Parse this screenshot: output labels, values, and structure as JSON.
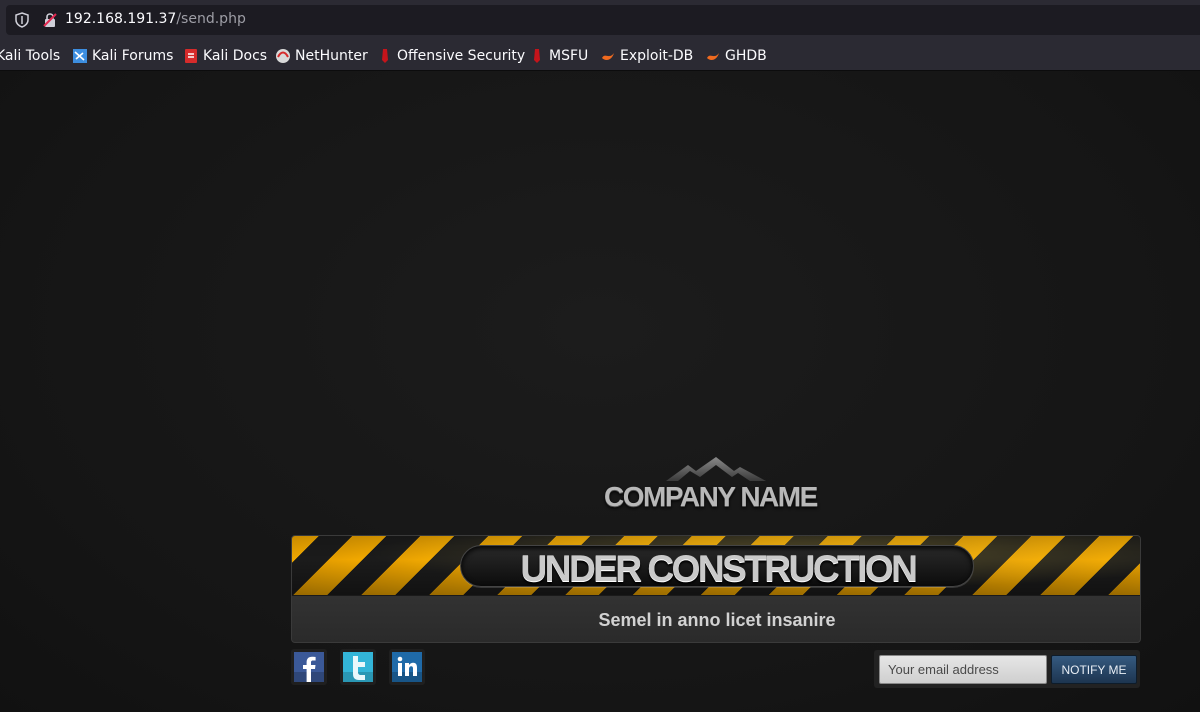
{
  "browser": {
    "url_host": "192.168.191.37",
    "url_path": "/send.php",
    "bookmarks": [
      {
        "label": "Kali Tools",
        "icon": "kali-tools-icon"
      },
      {
        "label": "Kali Forums",
        "icon": "kali-forums-icon"
      },
      {
        "label": "Kali Docs",
        "icon": "kali-docs-icon"
      },
      {
        "label": "NetHunter",
        "icon": "nethunter-icon"
      },
      {
        "label": "Offensive Security",
        "icon": "offsec-icon"
      },
      {
        "label": "MSFU",
        "icon": "msfu-icon"
      },
      {
        "label": "Exploit-DB",
        "icon": "exploit-db-icon"
      },
      {
        "label": "GHDB",
        "icon": "ghdb-icon"
      }
    ]
  },
  "page": {
    "company_name": "COMPANY NAME",
    "banner_title": "UNDER CONSTRUCTION",
    "tagline": "Semel in anno licet insanire",
    "social": [
      {
        "name": "facebook",
        "icon": "facebook-icon",
        "color": "#3b5998"
      },
      {
        "name": "twitter",
        "icon": "twitter-icon",
        "color": "#33b5d8"
      },
      {
        "name": "linkedin",
        "icon": "linkedin-icon",
        "color": "#1f6aa8"
      }
    ],
    "email_placeholder": "Your email address",
    "notify_label": "NOTIFY ME"
  }
}
